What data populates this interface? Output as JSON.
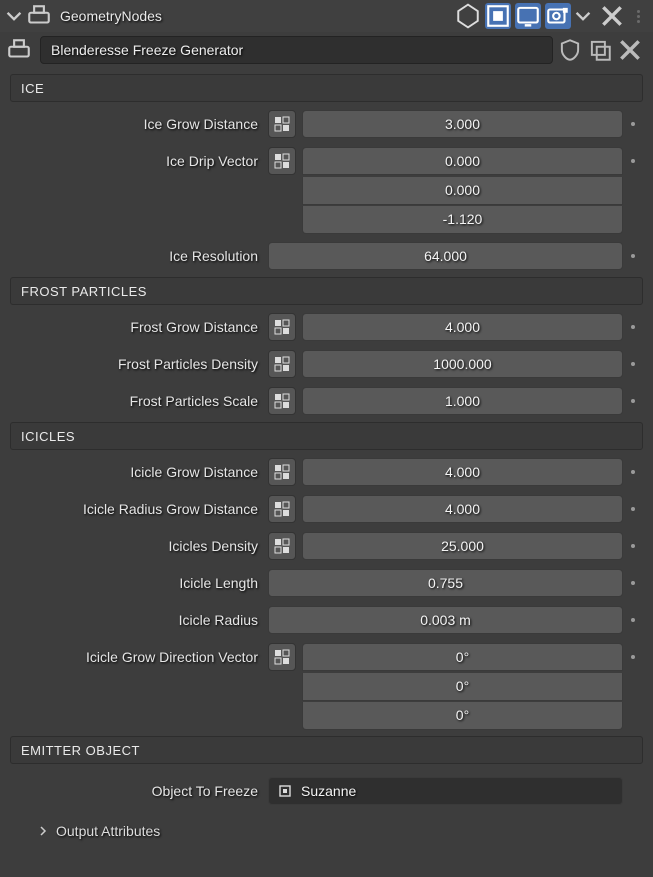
{
  "header": {
    "tab_title": "GeometryNodes"
  },
  "node_group": {
    "name": "Blenderesse Freeze Generator"
  },
  "sections": {
    "ice": {
      "title": "ICE",
      "grow_distance_label": "Ice Grow Distance",
      "grow_distance_value": "3.000",
      "drip_vector_label": "Ice Drip Vector",
      "drip_vector_x": "0.000",
      "drip_vector_y": "0.000",
      "drip_vector_z": "-1.120",
      "resolution_label": "Ice Resolution",
      "resolution_value": "64.000"
    },
    "frost": {
      "title": "FROST PARTICLES",
      "grow_distance_label": "Frost Grow Distance",
      "grow_distance_value": "4.000",
      "density_label": "Frost Particles Density",
      "density_value": "1000.000",
      "scale_label": "Frost Particles Scale",
      "scale_value": "1.000"
    },
    "icicles": {
      "title": "ICICLES",
      "grow_distance_label": "Icicle Grow Distance",
      "grow_distance_value": "4.000",
      "radius_grow_label": "Icicle Radius Grow Distance",
      "radius_grow_value": "4.000",
      "density_label": "Icicles Density",
      "density_value": "25.000",
      "length_label": "Icicle Length",
      "length_value": "0.755",
      "radius_label": "Icicle Radius",
      "radius_value": "0.003 m",
      "dir_vector_label": "Icicle Grow Direction Vector",
      "dir_x": "0°",
      "dir_y": "0°",
      "dir_z": "0°"
    },
    "emitter": {
      "title": "EMITTER OBJECT",
      "object_label": "Object To Freeze",
      "object_value": "Suzanne"
    }
  },
  "footer": {
    "output_attrs_label": "Output Attributes"
  }
}
